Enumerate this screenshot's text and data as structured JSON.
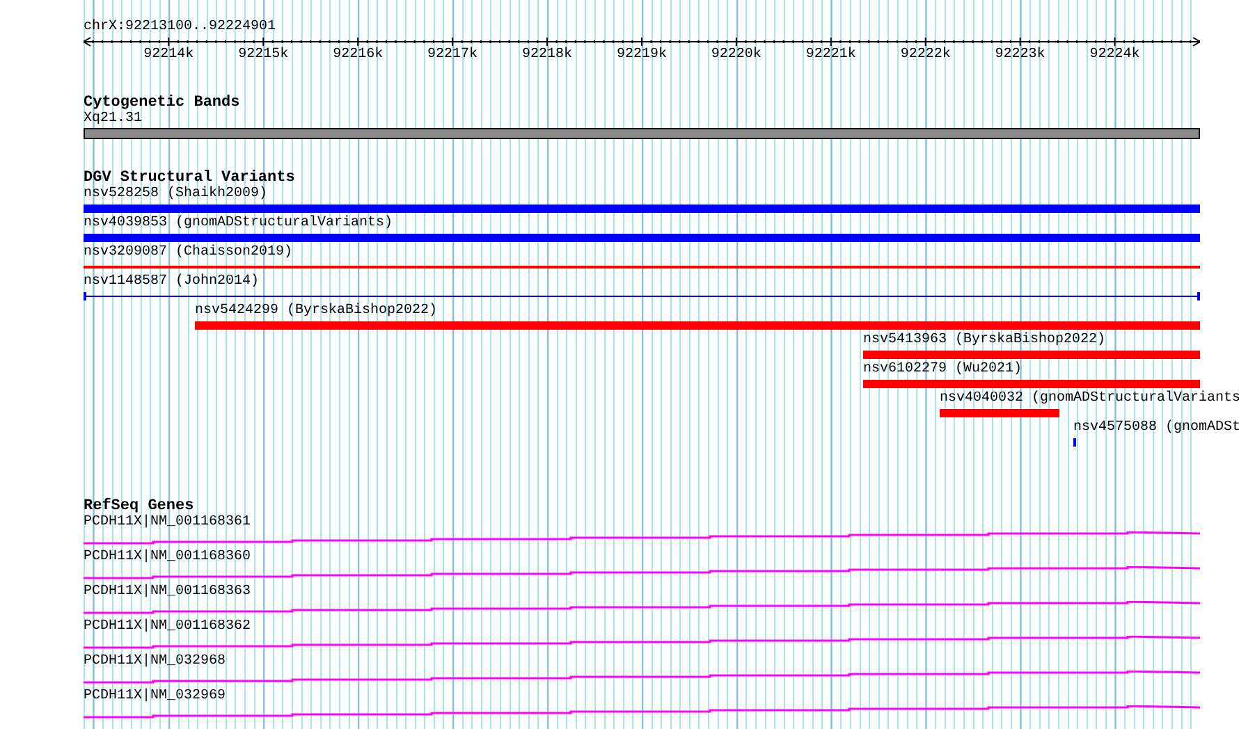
{
  "ruler": {
    "title": "chrX:92213100..92224901",
    "ticks": [
      "92214k",
      "92215k",
      "92216k",
      "92217k",
      "92218k",
      "92219k",
      "92220k",
      "92221k",
      "92222k",
      "92223k",
      "92224k"
    ]
  },
  "tracks": [
    {
      "title": "Cytogenetic Bands",
      "features": [
        {
          "kind": "band",
          "label": "Xq21.31"
        }
      ]
    },
    {
      "title": "DGV Structural Variants",
      "features": [
        {
          "kind": "bar",
          "label": "nsv528258 (Shaikh2009)",
          "color": "#0000ff"
        },
        {
          "kind": "bar",
          "label": "nsv4039853 (gnomADStructuralVariants)",
          "color": "#0000ff"
        },
        {
          "kind": "line",
          "label": "nsv3209087 (Chaisson2019)",
          "color": "#ff0000"
        },
        {
          "kind": "span",
          "label": "nsv1148587 (John2014)",
          "color": "#0000ff"
        },
        {
          "kind": "bar",
          "label": "nsv5424299 (ByrskaBishop2022)",
          "color": "#ff0000"
        },
        {
          "kind": "bar",
          "label": "nsv5413963 (ByrskaBishop2022)",
          "color": "#ff0000"
        },
        {
          "kind": "bar",
          "label": "nsv6102279 (Wu2021)",
          "color": "#ff0000"
        },
        {
          "kind": "bar",
          "label": "nsv4040032 (gnomADStructuralVariants",
          "color": "#ff0000"
        },
        {
          "kind": "tick",
          "label": "nsv4575088 (gnomADSt",
          "color": "#0000ff"
        }
      ]
    },
    {
      "title": "RefSeq Genes",
      "features": [
        {
          "kind": "transcript",
          "label": "PCDH11X|NM_001168361"
        },
        {
          "kind": "transcript",
          "label": "PCDH11X|NM_001168360"
        },
        {
          "kind": "transcript",
          "label": "PCDH11X|NM_001168363"
        },
        {
          "kind": "transcript",
          "label": "PCDH11X|NM_001168362"
        },
        {
          "kind": "transcript",
          "label": "PCDH11X|NM_032968"
        },
        {
          "kind": "transcript",
          "label": "PCDH11X|NM_032969"
        }
      ]
    }
  ]
}
